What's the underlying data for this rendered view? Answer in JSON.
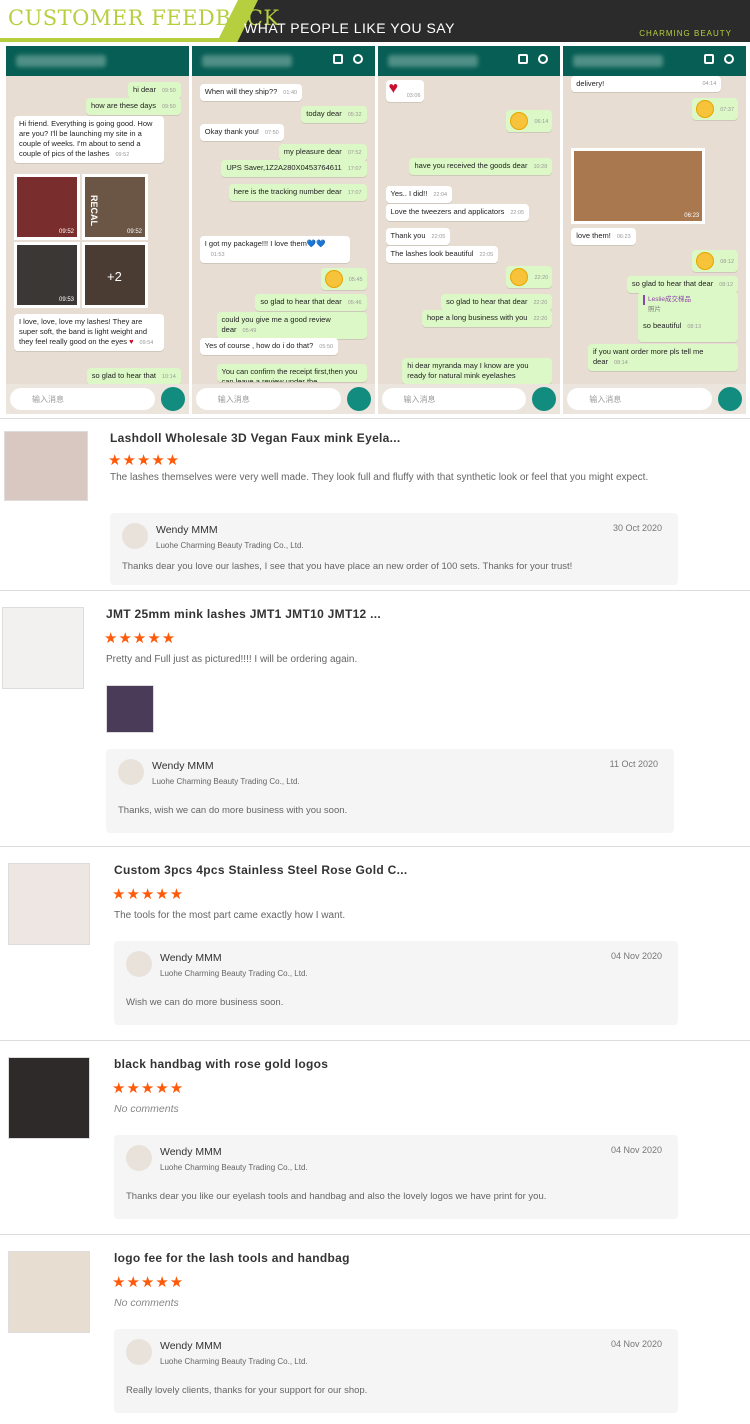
{
  "banner": {
    "title": "CUSTOMER FEEDBACK",
    "subtitle": "WHAT PEOPLE LIKE YOU SAY",
    "brand": "CHARMING BEAUTY"
  },
  "chats": {
    "input_placeholder": "输入消息",
    "c1": [
      {
        "text": "hi dear",
        "time": "09:50"
      },
      {
        "text": "how are these days",
        "time": "09:50"
      },
      {
        "text": "Hi friend. Everything is going good. How are you? I'll be launching my site in a couple of weeks. I'm about to send a couple of pics of the lashes",
        "time": "09:52"
      },
      {
        "text": "09:52",
        "time": ""
      },
      {
        "text": "09:52",
        "time": ""
      },
      {
        "text": "09:53",
        "time": ""
      },
      {
        "text": "+2",
        "time": ""
      },
      {
        "text": "I love, love, love my lashes! They are super soft, the band is light weight and they feel really good on the eyes",
        "time": "09:54"
      },
      {
        "text": "so glad to hear that",
        "time": "10:14"
      },
      {
        "text": "RECAL",
        "time": ""
      }
    ],
    "c2": [
      {
        "text": "When will they ship??",
        "time": "01:40"
      },
      {
        "text": "today dear",
        "time": "05:32"
      },
      {
        "text": "Okay thank you!",
        "time": "07:50"
      },
      {
        "text": "my pleasure dear",
        "time": "07:52"
      },
      {
        "text": "UPS Saver,1Z2A280X0453764611",
        "time": "17:07"
      },
      {
        "text": "here is the tracking number dear",
        "time": "17:07"
      },
      {
        "text": "I got my package!!! I love them💙💙",
        "time": "01:53"
      },
      {
        "text": "",
        "time": "05:45"
      },
      {
        "text": "so glad to hear that dear",
        "time": "05:46"
      },
      {
        "text": "could you give me a good review dear",
        "time": "05:49"
      },
      {
        "text": "Yes of course , how do i do that?",
        "time": "05:50"
      },
      {
        "text": "You can confirm the receipt first,then you can leave a review under the",
        "time": ""
      }
    ],
    "c3": [
      {
        "text": "03:06",
        "time": ""
      },
      {
        "text": "",
        "time": "06:14"
      },
      {
        "text": "have you received the goods dear",
        "time": "10:28"
      },
      {
        "text": "Yes.. I did!!",
        "time": "22:04"
      },
      {
        "text": "Love the tweezers and applicators",
        "time": "22:05"
      },
      {
        "text": "Thank you",
        "time": "22:05"
      },
      {
        "text": "The lashes look beautiful",
        "time": "22:05"
      },
      {
        "text": "",
        "time": "22:20"
      },
      {
        "text": "so glad to hear that dear",
        "time": "22:20"
      },
      {
        "text": "hope a long business with you",
        "time": "22:20"
      },
      {
        "text": "hi dear myranda may I know are you ready for natural mink eyelashes",
        "time": ""
      }
    ],
    "c4": [
      {
        "text": "delivery!",
        "time": "04:14"
      },
      {
        "text": "",
        "time": "07:37"
      },
      {
        "text": "06:23",
        "time": ""
      },
      {
        "text": "love them!",
        "time": "06:23"
      },
      {
        "text": "",
        "time": "08:12"
      },
      {
        "text": "so glad to hear that dear",
        "time": "08:12"
      },
      {
        "text": "Leslie成交梯品",
        "time": ""
      },
      {
        "text": "照片",
        "time": ""
      },
      {
        "text": "so beautiful",
        "time": "08:13"
      },
      {
        "text": "if you want order more pls tell me dear",
        "time": "08:14"
      }
    ]
  },
  "reviews": [
    {
      "title": "Lashdoll Wholesale 3D Vegan Faux mink Eyela...",
      "stars": "★★★★★",
      "text": "The lashes themselves were very well made. They look full and fluffy with that synthetic look or feel that you might expect.",
      "reply_name": "Wendy MMM",
      "reply_company": "Luohe Charming Beauty Trading Co., Ltd.",
      "reply_date": "30 Oct 2020",
      "reply_text": "Thanks dear you love our lashes, I see that you have place an new order of 100 sets. Thanks for your trust!"
    },
    {
      "title": "JMT 25mm mink lashes JMT1 JMT10 JMT12 ...",
      "stars": "★★★★★",
      "text": "Pretty and Full just as pictured!!!! I will be ordering again.",
      "reply_name": "Wendy MMM",
      "reply_company": "Luohe Charming Beauty Trading Co., Ltd.",
      "reply_date": "11 Oct 2020",
      "reply_text": "Thanks, wish we can do more business with you soon."
    },
    {
      "title": "Custom 3pcs 4pcs Stainless Steel Rose Gold C...",
      "stars": "★★★★★",
      "text": "The tools for the most part came exactly how I want.",
      "reply_name": "Wendy MMM",
      "reply_company": "Luohe Charming Beauty Trading Co., Ltd.",
      "reply_date": "04 Nov 2020",
      "reply_text": "Wish we can do more business soon."
    },
    {
      "title": "black handbag with rose gold logos",
      "stars": "★★★★★",
      "text": "No comments",
      "reply_name": "Wendy MMM",
      "reply_company": "Luohe Charming Beauty Trading Co., Ltd.",
      "reply_date": "04 Nov 2020",
      "reply_text": "Thanks dear you like our eyelash tools and handbag and also the lovely logos we have print for you."
    },
    {
      "title": "logo fee for the lash tools and handbag",
      "stars": "★★★★★",
      "text": "No comments",
      "reply_name": "Wendy MMM",
      "reply_company": "Luohe Charming Beauty Trading Co., Ltd.",
      "reply_date": "04 Nov 2020",
      "reply_text": "Really lovely clients, thanks for your support for our shop."
    }
  ]
}
